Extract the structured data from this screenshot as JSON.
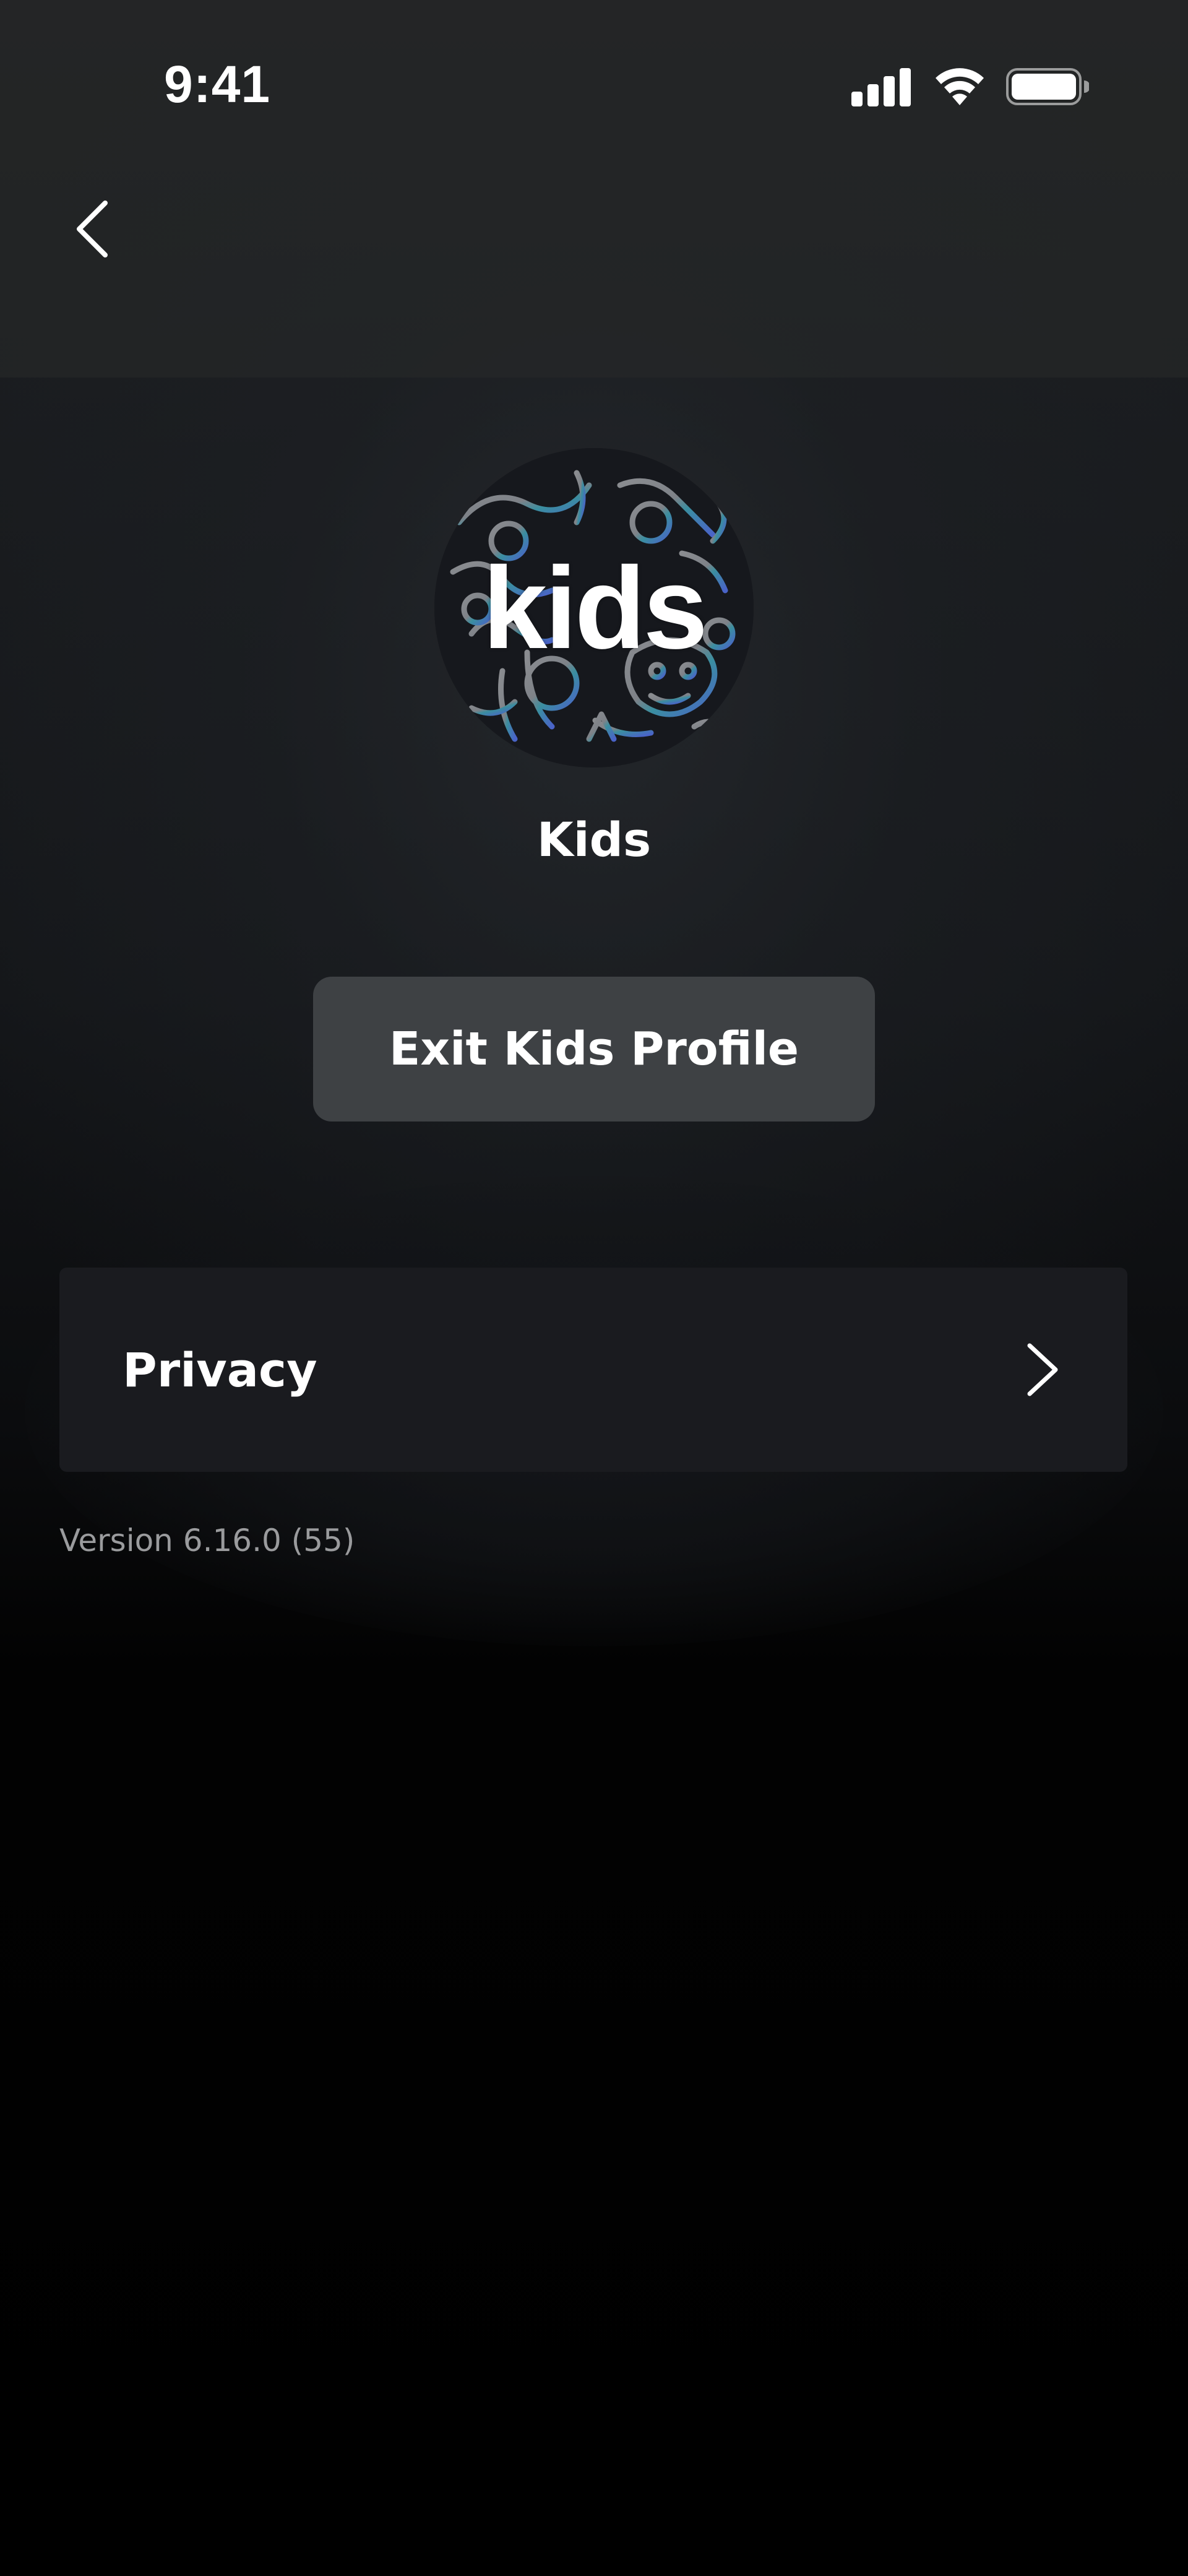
{
  "status_bar": {
    "time": "9:41",
    "signal_icon": "cellular-signal-icon",
    "wifi_icon": "wifi-icon",
    "battery_icon": "battery-full-icon"
  },
  "nav": {
    "back_icon": "chevron-left-icon"
  },
  "profile": {
    "avatar_text": "kids",
    "name": "Kids"
  },
  "actions": {
    "exit_label": "Exit Kids Profile"
  },
  "settings": {
    "items": [
      {
        "label": "Privacy",
        "icon": "chevron-right-icon"
      }
    ]
  },
  "footer": {
    "version": "Version 6.16.0 (55)"
  },
  "colors": {
    "background_top": "#1f2122",
    "background_bottom": "#000000",
    "button_bg": "#3e4144",
    "row_bg": "#1a1b1f",
    "version_text": "#9a9b9d"
  }
}
